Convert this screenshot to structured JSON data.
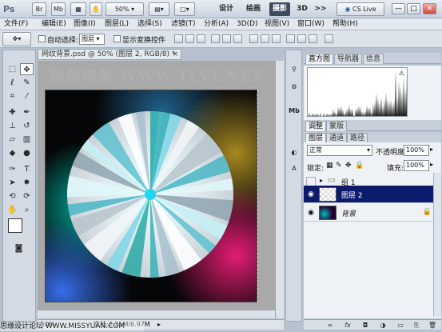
{
  "app": {
    "logo": "Ps",
    "zoom": "50%",
    "workspaces": [
      "设计",
      "绘画",
      "摄影",
      "3D"
    ],
    "active_workspace": "摄影",
    "more": ">>",
    "cslive": "CS Live",
    "minimize": "—",
    "restore": "□",
    "close": "✕",
    "br_icon": "Br",
    "mb_icon": "Mb"
  },
  "menu": [
    "文件(F)",
    "编辑(E)",
    "图像(I)",
    "图层(L)",
    "选择(S)",
    "滤镜(T)",
    "分析(A)",
    "3D(D)",
    "视图(V)",
    "窗口(W)",
    "帮助(H)"
  ],
  "options": {
    "auto_select_label": "自动选择:",
    "auto_select_value": "图层",
    "show_transform_label": "显示变换控件"
  },
  "document": {
    "tab_title": "网纹背景.psd @ 50% (图层 2, RGB/8) *",
    "tab_close": "×",
    "watermark": "腾龍視覺 WWW.TLVI.NET",
    "zoom": "50%",
    "doc_info": "文档:2.25M/6.97M"
  },
  "footer_watermark": "思缘设计论坛 WWW.MISSYUAN.COM",
  "panels": {
    "top_tabs": [
      "直方图",
      "导航器",
      "信息"
    ],
    "top_active": "直方图",
    "mid_tabs": [
      "调整",
      "蒙版"
    ],
    "mid_active": "调整",
    "layer_tabs": [
      "图层",
      "通道",
      "路径"
    ],
    "layer_active": "图层",
    "blend_mode": "正常",
    "opacity_label": "不透明度:",
    "opacity_value": "100%",
    "lock_label": "锁定:",
    "fill_label": "填充:",
    "fill_value": "100%",
    "layers": [
      {
        "name": "组 1",
        "type": "group",
        "visible": false,
        "selected": false
      },
      {
        "name": "图层 2",
        "type": "layer",
        "visible": true,
        "selected": true
      },
      {
        "name": "背景",
        "type": "background",
        "visible": true,
        "selected": false
      }
    ]
  },
  "footer_icons": [
    "link-icon",
    "fx-icon",
    "mask-icon",
    "adjustment-icon",
    "folder-icon",
    "new-layer-icon",
    "trash-icon"
  ]
}
